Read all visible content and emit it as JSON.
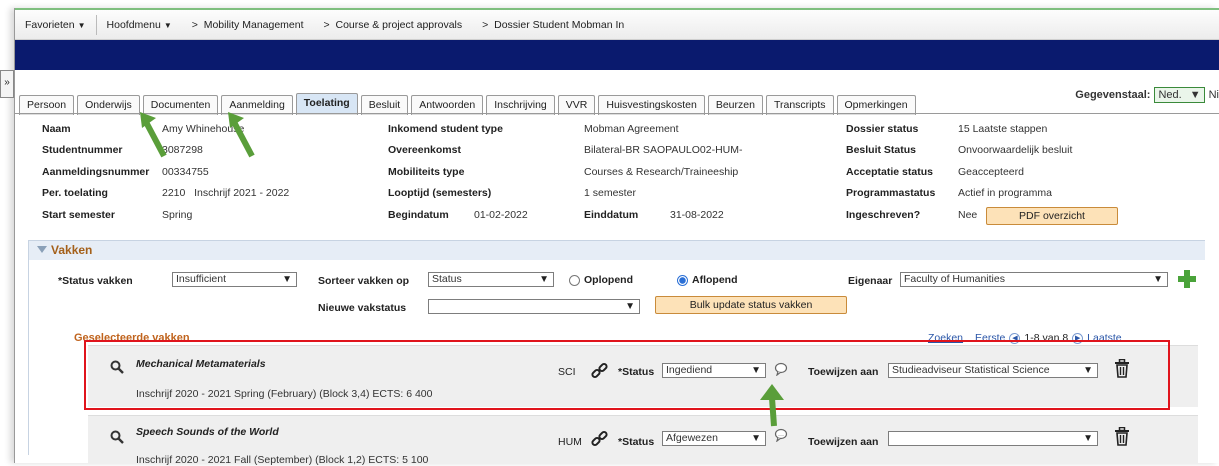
{
  "topnav": {
    "favorieten": "Favorieten",
    "hoofdmenu": "Hoofdmenu",
    "breadcrumbs": [
      "Mobility Management",
      "Course & project approvals",
      "Dossier Student Mobman In"
    ]
  },
  "language": {
    "label": "Gegevenstaal:",
    "value": "Ned.",
    "trailing": "Ni"
  },
  "tabs": [
    "Persoon",
    "Onderwijs",
    "Documenten",
    "Aanmelding",
    "Toelating",
    "Besluit",
    "Antwoorden",
    "Inschrijving",
    "VVR",
    "Huisvestingskosten",
    "Beurzen",
    "Transcripts",
    "Opmerkingen"
  ],
  "active_tab": "Toelating",
  "student": {
    "col1": [
      {
        "label": "Naam",
        "value": "Amy Whinehouse"
      },
      {
        "label": "Studentnummer",
        "value": "3087298"
      },
      {
        "label": "Aanmeldingsnummer",
        "value": "00334755"
      },
      {
        "label": "Per. toelating",
        "value": "2210   Inschrijf 2021 - 2022"
      },
      {
        "label": "Start semester",
        "value": "Spring"
      }
    ],
    "col2": [
      {
        "label": "Inkomend student type",
        "value": "Mobman Agreement"
      },
      {
        "label": "Overeenkomst",
        "value": "Bilateral-BR SAOPAULO02-HUM-"
      },
      {
        "label": "Mobiliteits type",
        "value": "Courses & Research/Traineeship"
      },
      {
        "label": "Looptijd (semesters)",
        "value": "1 semester"
      }
    ],
    "begindatum_label": "Begindatum",
    "begindatum": "01-02-2022",
    "einddatum_label": "Einddatum",
    "einddatum": "31-08-2022",
    "col3": [
      {
        "label": "Dossier status",
        "value": "15 Laatste stappen"
      },
      {
        "label": "Besluit Status",
        "value": "Onvoorwaardelijk besluit"
      },
      {
        "label": "Acceptatie status",
        "value": "Geaccepteerd"
      },
      {
        "label": "Programmastatus",
        "value": "Actief in programma"
      },
      {
        "label": "Ingeschreven?",
        "value": "Nee"
      }
    ],
    "pdf_button": "PDF overzicht"
  },
  "vakken": {
    "header": "Vakken",
    "status_vakken_label": "*Status vakken",
    "status_vakken_value": "Insufficient",
    "sorteer_label": "Sorteer vakken op",
    "sorteer_value": "Status",
    "oplopend": "Oplopend",
    "aflopend": "Aflopend",
    "eigenaar_label": "Eigenaar",
    "eigenaar_value": "Faculty of Humanities",
    "nieuwe_label": "Nieuwe vakstatus",
    "nieuwe_value": "",
    "bulk_button": "Bulk update status vakken",
    "geselecteerde": "Geselecteerde vakken",
    "zoeken": "Zoeken",
    "eerste": "Eerste",
    "range": "1-8 van 8",
    "laatste": "Laatste"
  },
  "courses": [
    {
      "title": "Mechanical Metamaterials",
      "sub": "Inschrijf 2020 - 2021  Spring (February) (Block 3,4)  ECTS: 6  400",
      "faculty": "SCI",
      "status_label": "*Status",
      "status": "Ingediend",
      "toewijzen_label": "Toewijzen aan",
      "toewijzen": "Studieadviseur Statistical Science"
    },
    {
      "title": "Speech Sounds of the World",
      "sub": "Inschrijf 2020 - 2021  Fall (September) (Block 1,2)  ECTS: 5  100",
      "faculty": "HUM",
      "status_label": "*Status",
      "status": "Afgewezen",
      "toewijzen_label": "Toewijzen aan",
      "toewijzen": ""
    }
  ],
  "colors": {
    "arrow": "#5a9e3a",
    "highlight": "#e0141c",
    "navbar": "#0a1a6e",
    "button": "#fde2b8"
  }
}
